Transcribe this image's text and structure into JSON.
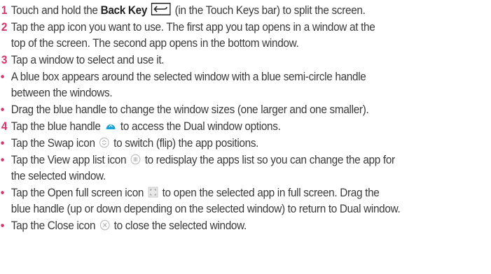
{
  "steps": [
    {
      "num": "1",
      "parts": {
        "a": "Touch and hold the ",
        "b": "Back Key",
        "c": " (in the Touch Keys bar) to split the screen."
      }
    },
    {
      "num": "2",
      "line1": "Tap the app icon you want to use. The first app you tap opens in a window at the",
      "line2": "top of the screen. The second app opens in the bottom window."
    },
    {
      "num": "3",
      "line1": "Tap a window to select and use it."
    },
    {
      "num": "4",
      "parts": {
        "a": "Tap the blue handle ",
        "c": " to access the Dual window options."
      }
    }
  ],
  "bullets": [
    {
      "line1": "A blue box appears around the selected window with a blue semi-circle handle",
      "line2": "between the windows."
    },
    {
      "line1": "Drag the blue handle to change the window sizes (one larger and one smaller)."
    },
    {
      "a": "Tap the Swap icon ",
      "c": " to switch (flip) the app positions."
    },
    {
      "a": "Tap the View app list icon ",
      "c": " to redisplay the apps list so you can change the app for",
      "line2": "the selected window."
    },
    {
      "a": "Tap the Open full screen icon ",
      "c": " to open the selected app in full screen. Drag the",
      "line2": "blue handle (up or down depending on the selected window) to return to Dual window."
    },
    {
      "a": "Tap the Close icon ",
      "c": " to close the selected window."
    }
  ],
  "bullet_char": "•",
  "colors": {
    "accent": "#d6336c",
    "handle": "#19a1d8",
    "text": "#3a3a3a"
  },
  "icons": [
    "back-key-icon",
    "blue-handle-icon",
    "swap-icon",
    "app-list-icon",
    "full-screen-icon",
    "close-icon"
  ]
}
